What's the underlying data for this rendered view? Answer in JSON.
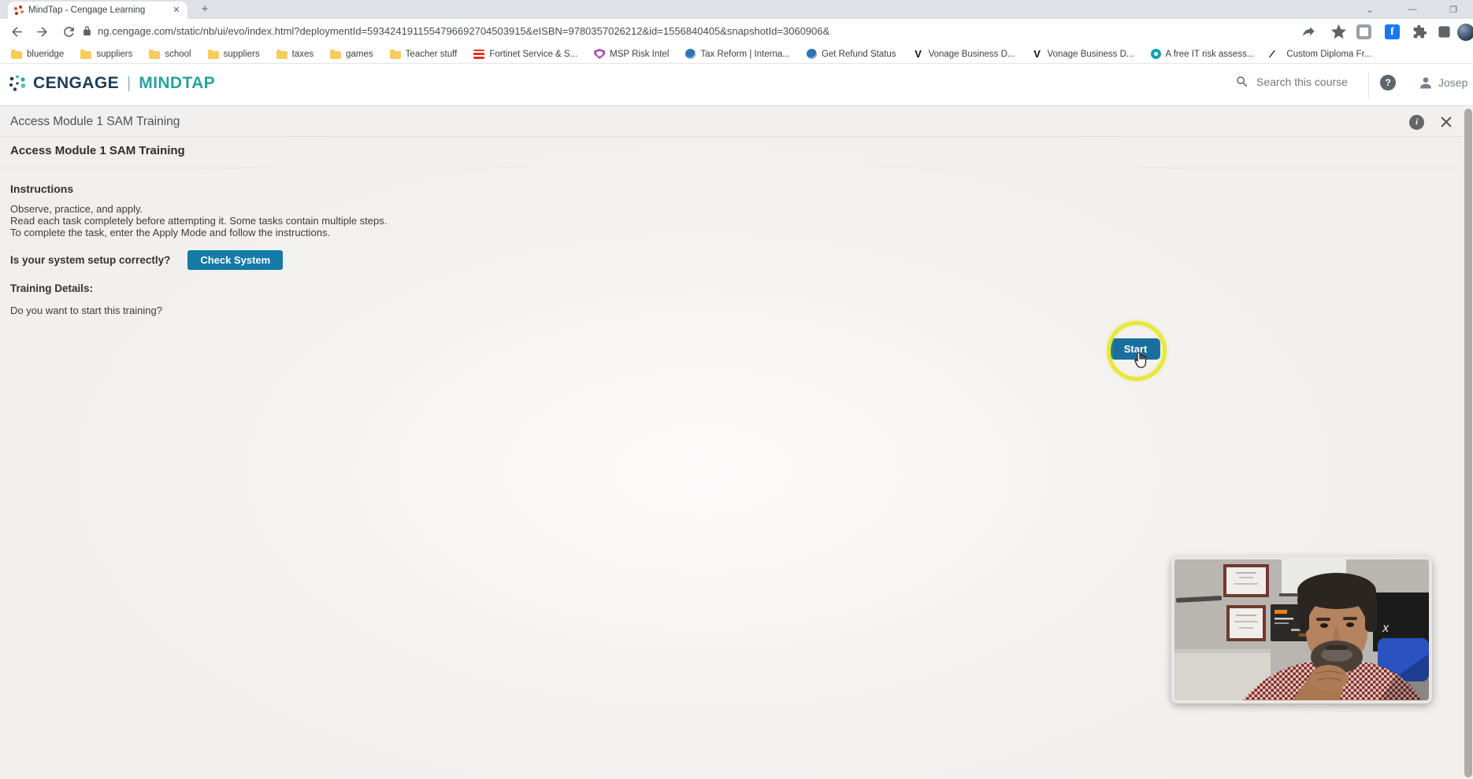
{
  "browser": {
    "tab_title": "MindTap - Cengage Learning",
    "url": "ng.cengage.com/static/nb/ui/evo/index.html?deploymentId=5934241911554796692704503915&eISBN=9780357026212&id=1556840405&snapshotId=3060906&",
    "bookmarks": [
      {
        "label": "blueridge",
        "icon": "folder-icon"
      },
      {
        "label": "suppliers",
        "icon": "folder-icon"
      },
      {
        "label": "school",
        "icon": "folder-icon"
      },
      {
        "label": "suppliers",
        "icon": "folder-icon"
      },
      {
        "label": "taxes",
        "icon": "folder-icon"
      },
      {
        "label": "games",
        "icon": "folder-icon"
      },
      {
        "label": "Teacher stuff",
        "icon": "folder-icon"
      },
      {
        "label": "Fortinet Service & S...",
        "icon": "fortinet-icon"
      },
      {
        "label": "MSP Risk Intel",
        "icon": "shield-icon"
      },
      {
        "label": "Tax Reform | Interna...",
        "icon": "irs-icon"
      },
      {
        "label": "Get Refund Status",
        "icon": "irs-icon"
      },
      {
        "label": "Vonage Business D...",
        "icon": "vonage-icon"
      },
      {
        "label": "Vonage Business D...",
        "icon": "vonage-icon"
      },
      {
        "label": "A free IT risk assess...",
        "icon": "eye-icon"
      },
      {
        "label": "Custom Diploma Fr...",
        "icon": "diploma-icon"
      }
    ]
  },
  "header": {
    "brand": "CENGAGE",
    "product": "MINDTAP",
    "search_label": "Search this course",
    "help_glyph": "?",
    "user_name": "Josep"
  },
  "activity": {
    "title": "Access Module 1 SAM Training",
    "info_glyph": "i"
  },
  "content": {
    "heading": "Access Module 1 SAM Training",
    "instructions_heading": "Instructions",
    "instructions": [
      "Observe, practice, and apply.",
      "Read each task completely before attempting it. Some tasks contain multiple steps.",
      "To complete the task, enter the Apply Mode and follow the instructions."
    ],
    "system_question": "Is your system setup correctly?",
    "check_system_label": "Check System",
    "training_details_heading": "Training Details:",
    "training_question": "Do you want to start this training?",
    "start_label": "Start"
  },
  "colors": {
    "brand_navy": "#1d3c5a",
    "brand_teal": "#27a49e",
    "button_blue": "#147ba6",
    "start_blue": "#186f9d",
    "highlight_yellow": "#e6e83c"
  }
}
